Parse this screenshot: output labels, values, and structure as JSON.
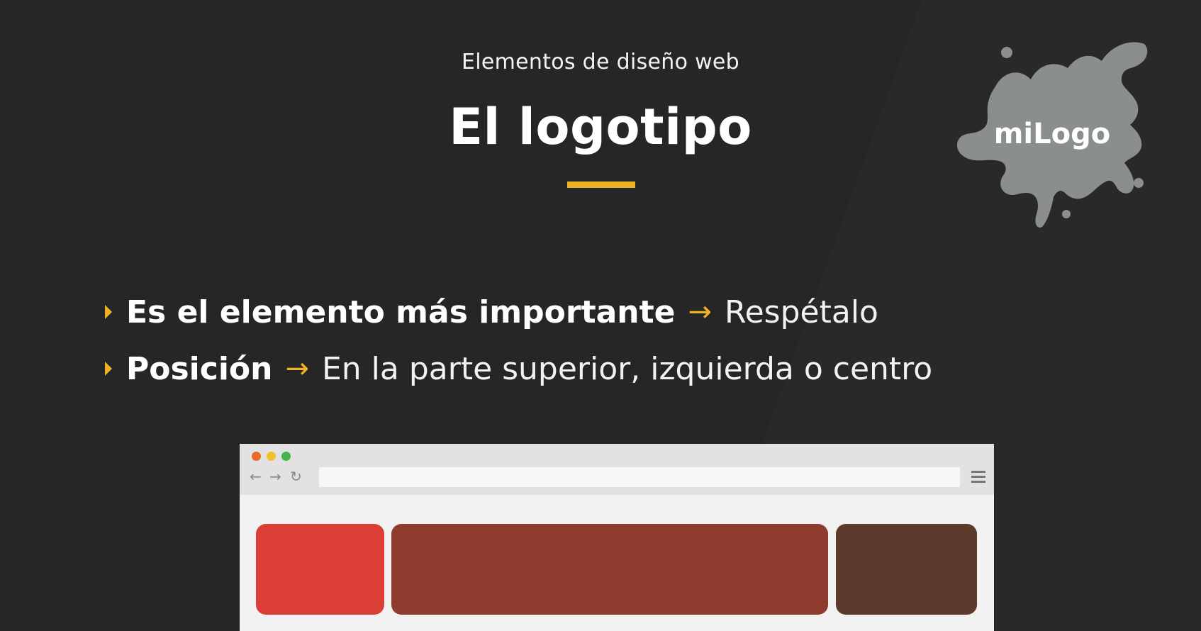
{
  "slide": {
    "subtitle": "Elementos de diseño web",
    "title": "El logotipo",
    "accent_color": "#f0b323",
    "logo": {
      "text": "miLogo",
      "shape": "gray-paint-splat",
      "color": "#8a8e8e"
    },
    "bullets": [
      {
        "icon": "caret-right-icon",
        "strong": "Es el elemento más importante",
        "arrow": "→",
        "detail": "Respétalo"
      },
      {
        "icon": "caret-right-icon",
        "strong": "Posición",
        "arrow": "→",
        "detail": "En la parte superior, izquierda o centro"
      }
    ],
    "browser_mockup": {
      "window_dots": [
        "#e86a2a",
        "#f2c22d",
        "#48b54a"
      ],
      "nav_icons": [
        "←",
        "→",
        "↻"
      ],
      "menu_icon": "hamburger-icon",
      "blocks": [
        {
          "name": "logo-block",
          "color": "#db3e36"
        },
        {
          "name": "nav-block",
          "color": "#8f3b2d"
        },
        {
          "name": "side-block",
          "color": "#5c3b2d"
        }
      ]
    }
  }
}
